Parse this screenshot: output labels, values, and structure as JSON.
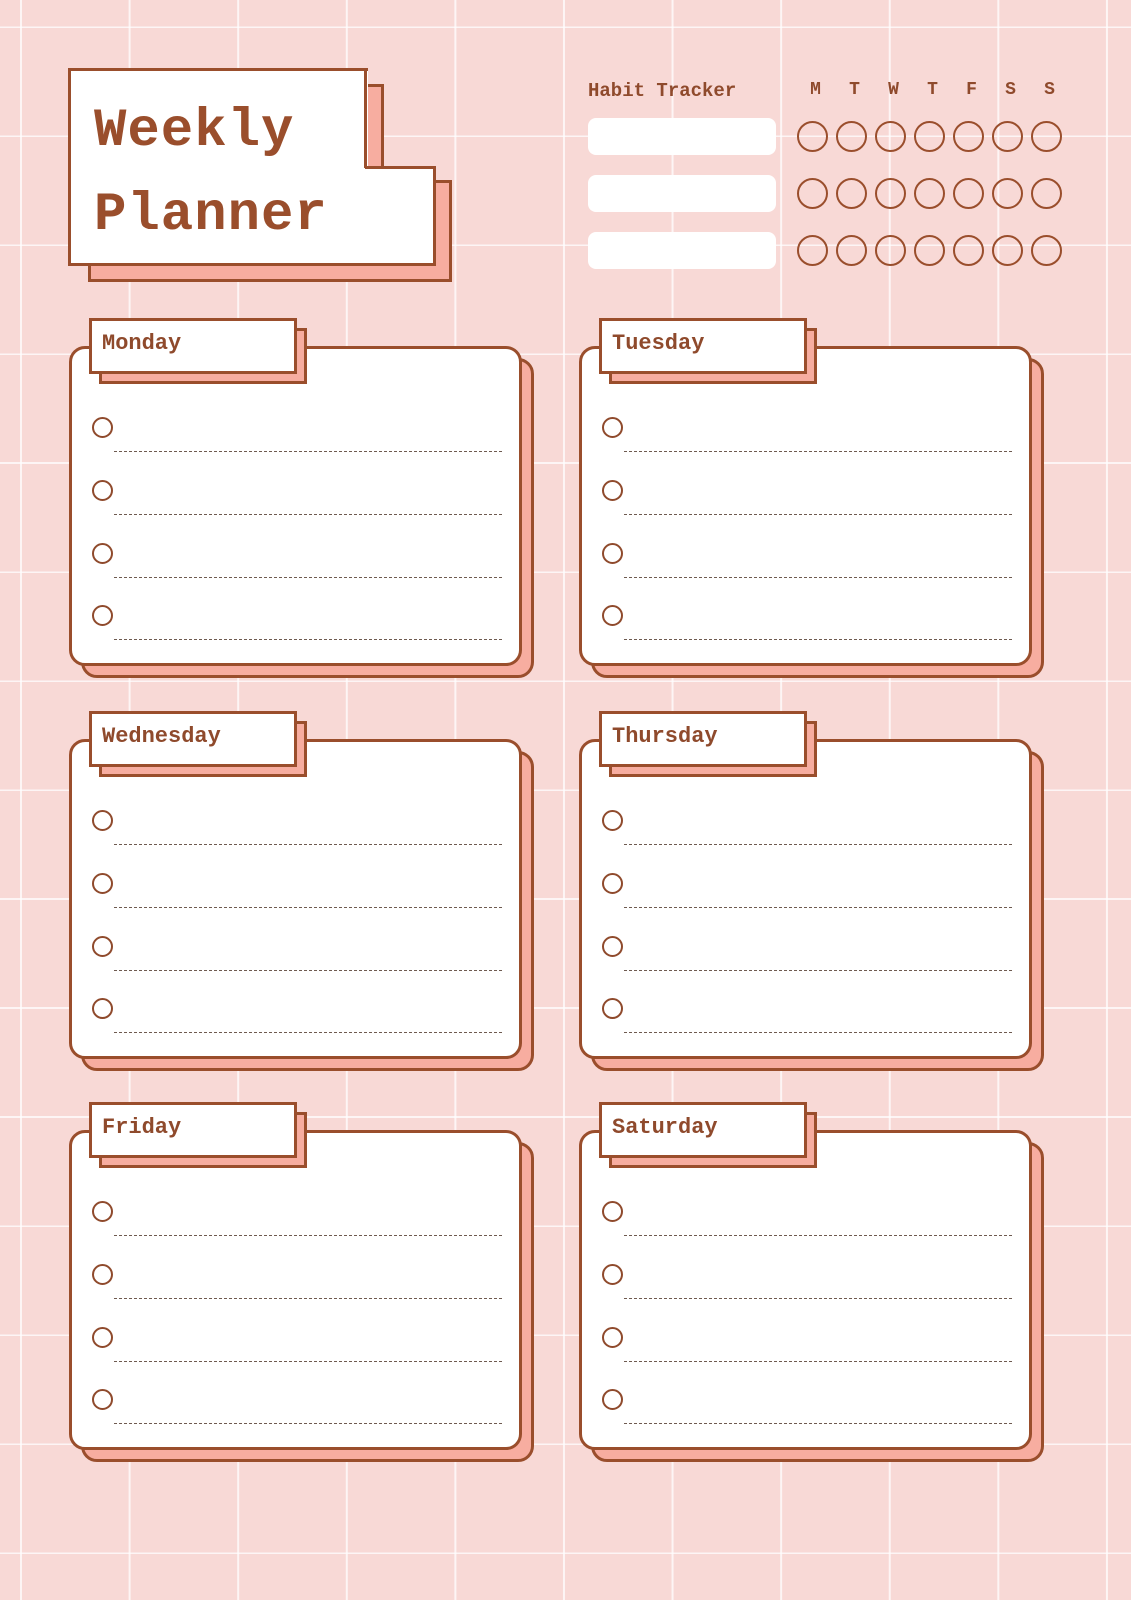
{
  "title": {
    "line1": "Weekly",
    "line2": "Planner"
  },
  "habit_tracker": {
    "title": "Habit Tracker",
    "days": [
      "M",
      "T",
      "W",
      "T",
      "F",
      "S",
      "S"
    ],
    "habits": [
      {
        "value": "",
        "checks": [
          false,
          false,
          false,
          false,
          false,
          false,
          false
        ]
      },
      {
        "value": "",
        "checks": [
          false,
          false,
          false,
          false,
          false,
          false,
          false
        ]
      },
      {
        "value": "",
        "checks": [
          false,
          false,
          false,
          false,
          false,
          false,
          false
        ]
      }
    ]
  },
  "days": [
    {
      "label": "Monday",
      "tasks": [
        "",
        "",
        "",
        ""
      ]
    },
    {
      "label": "Tuesday",
      "tasks": [
        "",
        "",
        "",
        ""
      ]
    },
    {
      "label": "Wednesday",
      "tasks": [
        "",
        "",
        "",
        ""
      ]
    },
    {
      "label": "Thursday",
      "tasks": [
        "",
        "",
        "",
        ""
      ]
    },
    {
      "label": "Friday",
      "tasks": [
        "",
        "",
        "",
        ""
      ]
    },
    {
      "label": "Saturday",
      "tasks": [
        "",
        "",
        "",
        ""
      ]
    }
  ],
  "colors": {
    "background": "#f8d9d6",
    "accent_brown": "#9a4e2c",
    "shadow_salmon": "#f7ada0",
    "card": "#ffffff"
  }
}
